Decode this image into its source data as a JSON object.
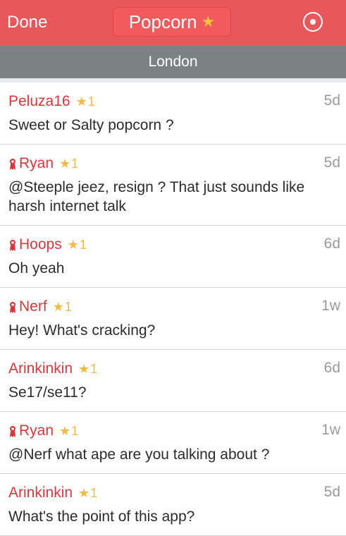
{
  "nav": {
    "done_label": "Done",
    "title": "Popcorn",
    "title_star": "★",
    "target_icon": "target-icon"
  },
  "location": "London",
  "posts": [
    {
      "user": "Peluza16",
      "badge": false,
      "star": "★",
      "score": "1",
      "age": "5d",
      "message": "Sweet or Salty popcorn ?"
    },
    {
      "user": "Ryan",
      "badge": true,
      "star": "★",
      "score": "1",
      "age": "5d",
      "message": "@Steeple jeez, resign ? That just sounds like harsh internet talk"
    },
    {
      "user": "Hoops",
      "badge": true,
      "star": "★",
      "score": "1",
      "age": "6d",
      "message": "Oh yeah"
    },
    {
      "user": "Nerf",
      "badge": true,
      "star": "★",
      "score": "1",
      "age": "1w",
      "message": "Hey! What's cracking?"
    },
    {
      "user": "Arinkinkin",
      "badge": false,
      "star": "★",
      "score": "1",
      "age": "6d",
      "message": "Se17/se11?"
    },
    {
      "user": "Ryan",
      "badge": true,
      "star": "★",
      "score": "1",
      "age": "1w",
      "message": "@Nerf what ape are you talking about ?"
    },
    {
      "user": "Arinkinkin",
      "badge": false,
      "star": "★",
      "score": "1",
      "age": "5d",
      "message": "What's the point of this app?"
    }
  ],
  "colors": {
    "nav_bg": "#e8575c",
    "location_bg": "#7c8284",
    "username": "#d9363c",
    "star": "#f0b94a",
    "age": "#9a9a9a"
  }
}
